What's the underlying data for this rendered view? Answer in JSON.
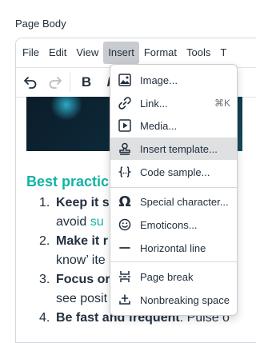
{
  "page": {
    "label": "Page Body"
  },
  "menubar": {
    "items": [
      "File",
      "Edit",
      "View",
      "Insert",
      "Format",
      "Tools",
      "T"
    ]
  },
  "content": {
    "heading": "Best practic",
    "list": [
      {
        "num": "1.",
        "bold": "Keep it s",
        "line2_pre": "avoid ",
        "line2_teal": "su"
      },
      {
        "num": "2.",
        "bold": "Make it r",
        "line2": "know’ ite"
      },
      {
        "num": "3.",
        "bold": "Focus or",
        "line2": "see posit"
      },
      {
        "num": "4.",
        "bold": "Be fast and frequent",
        "rest": ". Pulse o"
      }
    ]
  },
  "insert_menu": {
    "items": [
      {
        "label": "Image...",
        "icon": "image-icon"
      },
      {
        "label": "Link...",
        "icon": "link-icon",
        "shortcut": "⌘K"
      },
      {
        "label": "Media...",
        "icon": "media-icon"
      },
      {
        "label": "Insert template...",
        "icon": "template-icon"
      },
      {
        "label": "Code sample...",
        "icon": "code-sample-icon"
      },
      {
        "label": "Special character...",
        "icon": "omega-icon"
      },
      {
        "label": "Emoticons...",
        "icon": "emoticon-icon"
      },
      {
        "label": "Horizontal line",
        "icon": "horizontal-line-icon"
      },
      {
        "label": "Page break",
        "icon": "page-break-icon"
      },
      {
        "label": "Nonbreaking space",
        "icon": "nonbreaking-space-icon"
      }
    ]
  },
  "colors": {
    "accent": "#12b3a4",
    "text": "#222f3e",
    "hover": "#dee0e2",
    "menu_active": "#c8cbcf"
  }
}
